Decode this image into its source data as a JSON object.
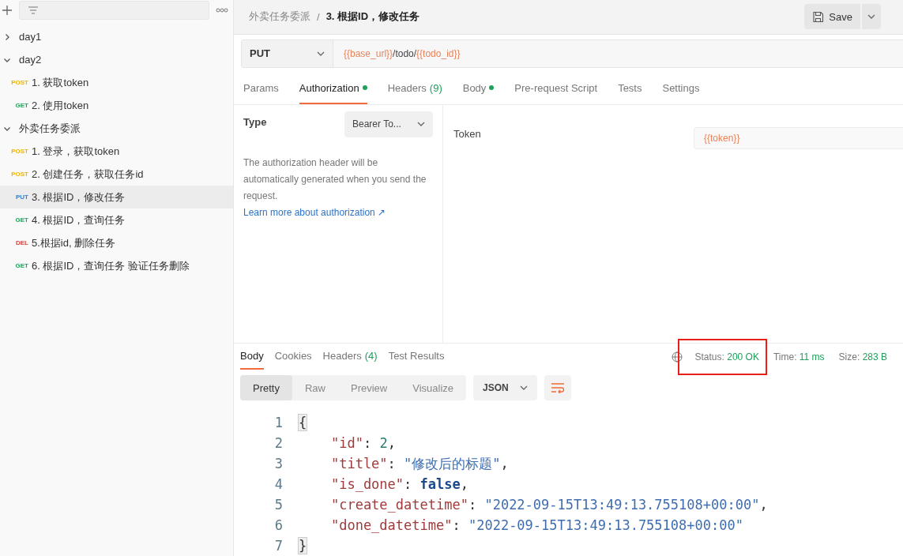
{
  "sidebar": {
    "tree": [
      {
        "name": "day1",
        "expanded": false
      },
      {
        "name": "day2",
        "expanded": true,
        "children": [
          {
            "method": "POST",
            "name": "1. 获取token",
            "selected": false
          },
          {
            "method": "GET",
            "name": "2. 使用token",
            "selected": false
          }
        ]
      },
      {
        "name": "外卖任务委派",
        "expanded": true,
        "children": [
          {
            "method": "POST",
            "name": "1. 登录，获取token",
            "selected": false
          },
          {
            "method": "POST",
            "name": "2. 创建任务，获取任务id",
            "selected": false
          },
          {
            "method": "PUT",
            "name": "3. 根据ID，修改任务",
            "selected": true
          },
          {
            "method": "GET",
            "name": "4. 根据ID，查询任务",
            "selected": false
          },
          {
            "method": "DEL",
            "name": "5.根据id, 删除任务",
            "selected": false
          },
          {
            "method": "GET",
            "name": "6. 根据ID，查询任务 验证任务删除",
            "selected": false
          }
        ]
      }
    ]
  },
  "breadcrumb": {
    "parent": "外卖任务委派",
    "separator": "/",
    "current": "3. 根据ID，修改任务"
  },
  "save_button": {
    "label": "Save"
  },
  "request": {
    "method": "PUT",
    "url": [
      {
        "kind": "var",
        "text": "{{base_url}}"
      },
      {
        "kind": "plain",
        "text": "/todo/"
      },
      {
        "kind": "var",
        "text": "{{todo_id}}"
      }
    ]
  },
  "request_tabs": [
    {
      "label": "Params",
      "selected": false,
      "dot": false
    },
    {
      "label": "Authorization",
      "selected": true,
      "dot": true
    },
    {
      "label": "Headers",
      "count": "(9)",
      "selected": false,
      "dot": false
    },
    {
      "label": "Body",
      "selected": false,
      "dot": true
    },
    {
      "label": "Pre-request Script",
      "selected": false,
      "dot": false
    },
    {
      "label": "Tests",
      "selected": false,
      "dot": false
    },
    {
      "label": "Settings",
      "selected": false,
      "dot": false
    }
  ],
  "auth": {
    "type_label": "Type",
    "type_value": "Bearer To...",
    "description": "The authorization header will be automatically generated when you send the request.",
    "link": "Learn more about authorization ↗",
    "token_label": "Token",
    "token_value": "{{token}}"
  },
  "response_tabs": [
    {
      "label": "Body",
      "selected": true
    },
    {
      "label": "Cookies",
      "selected": false
    },
    {
      "label": "Headers",
      "count": "(4)",
      "selected": false
    },
    {
      "label": "Test Results",
      "selected": false
    }
  ],
  "response_stats": [
    {
      "label": "Status:",
      "value": "200 OK",
      "highlighted": true
    },
    {
      "label": "Time:",
      "value": "11 ms",
      "highlighted": false
    },
    {
      "label": "Size:",
      "value": "283 B",
      "highlighted": false
    }
  ],
  "view_modes": [
    {
      "label": "Pretty",
      "selected": true
    },
    {
      "label": "Raw",
      "selected": false
    },
    {
      "label": "Preview",
      "selected": false
    },
    {
      "label": "Visualize",
      "selected": false
    }
  ],
  "format_select": {
    "value": "JSON"
  },
  "code_lines": [
    {
      "number": "1",
      "tokens": [
        {
          "kind": "brace",
          "text": "{"
        }
      ]
    },
    {
      "number": "2",
      "indented": true,
      "tokens": [
        {
          "kind": "key",
          "text": "\"id\""
        },
        {
          "kind": "punct",
          "text": ": "
        },
        {
          "kind": "number",
          "text": "2"
        },
        {
          "kind": "punct",
          "text": ","
        }
      ]
    },
    {
      "number": "3",
      "indented": true,
      "tokens": [
        {
          "kind": "key",
          "text": "\"title\""
        },
        {
          "kind": "punct",
          "text": ": "
        },
        {
          "kind": "string",
          "text": "\"修改后的标题\""
        },
        {
          "kind": "punct",
          "text": ","
        }
      ]
    },
    {
      "number": "4",
      "indented": true,
      "tokens": [
        {
          "kind": "key",
          "text": "\"is_done\""
        },
        {
          "kind": "punct",
          "text": ": "
        },
        {
          "kind": "bool",
          "text": "false"
        },
        {
          "kind": "punct",
          "text": ","
        }
      ]
    },
    {
      "number": "5",
      "indented": true,
      "tokens": [
        {
          "kind": "key",
          "text": "\"create_datetime\""
        },
        {
          "kind": "punct",
          "text": ": "
        },
        {
          "kind": "string",
          "text": "\"2022-09-15T13:49:13.755108+00:00\""
        },
        {
          "kind": "punct",
          "text": ","
        }
      ]
    },
    {
      "number": "6",
      "indented": true,
      "tokens": [
        {
          "kind": "key",
          "text": "\"done_datetime\""
        },
        {
          "kind": "punct",
          "text": ": "
        },
        {
          "kind": "string",
          "text": "\"2022-09-15T13:49:13.755108+00:00\""
        }
      ]
    },
    {
      "number": "7",
      "tokens": [
        {
          "kind": "brace",
          "text": "}"
        }
      ]
    }
  ]
}
